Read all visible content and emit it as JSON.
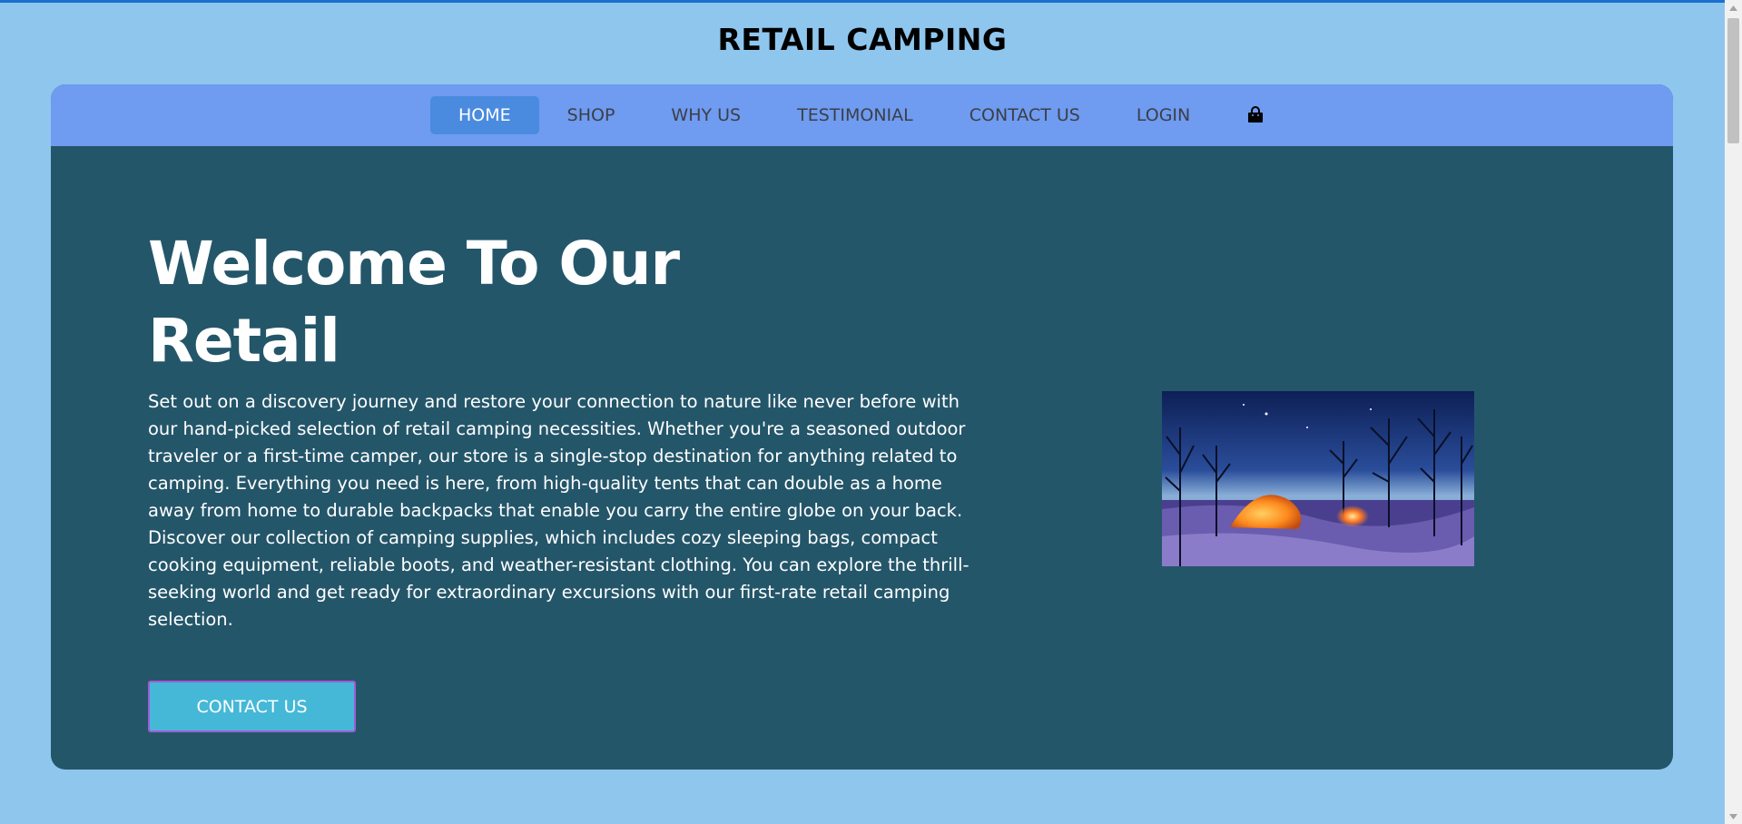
{
  "site": {
    "title": "RETAIL CAMPING"
  },
  "nav": {
    "items": [
      {
        "label": "HOME",
        "active": true
      },
      {
        "label": "SHOP",
        "active": false
      },
      {
        "label": "WHY US",
        "active": false
      },
      {
        "label": "TESTIMONIAL",
        "active": false
      },
      {
        "label": "CONTACT US",
        "active": false
      },
      {
        "label": "LOGIN",
        "active": false
      }
    ],
    "cart_icon": "shopping-bag-icon"
  },
  "hero": {
    "title": "Welcome To Our Retail",
    "description": "Set out on a discovery journey and restore your connection to nature like never before with our hand-picked selection of retail camping necessities. Whether you're a seasoned outdoor traveler or a first-time camper, our store is a single-stop destination for anything related to camping. Everything you need is here, from high-quality tents that can double as a home away from home to durable backpacks that enable you carry the entire globe on your back. Discover our collection of camping supplies, which includes cozy sleeping bags, compact cooking equipment, reliable boots, and weather-resistant clothing. You can explore the thrill-seeking world and get ready for extraordinary excursions with our first-rate retail camping selection.",
    "cta_label": "CONTACT US",
    "image": "night-camping-tent-photo"
  },
  "colors": {
    "page_bg": "#8fc6ee",
    "navbar_bg": "#6f9bf0",
    "nav_active_bg": "#4a8be0",
    "hero_bg": "#24566a",
    "cta_bg": "#45b8d8",
    "cta_border": "#a25ad8"
  }
}
